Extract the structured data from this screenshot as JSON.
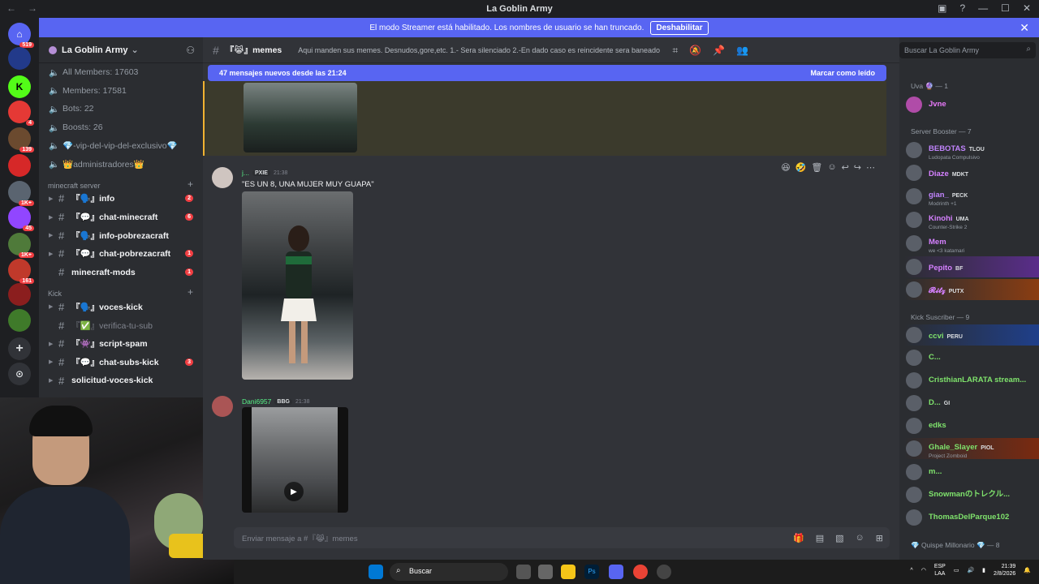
{
  "window": {
    "title": "La Goblin Army"
  },
  "banner": {
    "text": "El modo Streamer está habilitado. Los nombres de usuario se han truncado.",
    "button": "Deshabilitar"
  },
  "servers": [
    {
      "badge": "519"
    },
    {
      "badge": ""
    },
    {
      "badge": ""
    },
    {
      "badge": "4"
    },
    {
      "badge": "139"
    },
    {
      "badge": ""
    },
    {
      "badge": "1K+"
    },
    {
      "badge": "45"
    },
    {
      "badge": "1K+"
    },
    {
      "badge": "161"
    },
    {
      "badge": ""
    },
    {
      "badge": ""
    }
  ],
  "guild": {
    "name": "La Goblin Army"
  },
  "stats": [
    "All Members: 17603",
    "Members: 17581",
    "Bots: 22",
    "Boosts: 26",
    "💎-vip-del-vip-del-exclusivo💎",
    "👑administradores👑"
  ],
  "categories": {
    "minecraft": "minecraft server",
    "kick": "Kick"
  },
  "channels_mc": [
    {
      "name": "『🗣️』info",
      "badge": "2"
    },
    {
      "name": "『💬』chat-minecraft",
      "badge": "6"
    },
    {
      "name": "『🗣️』info-pobrezacraft",
      "badge": ""
    },
    {
      "name": "『💬』chat-pobrezacraft",
      "badge": "1"
    },
    {
      "name": "minecraft-mods",
      "badge": "1"
    }
  ],
  "channels_kick": [
    {
      "name": "『🗣️』voces-kick",
      "badge": ""
    },
    {
      "name": "『✅』verifica-tu-sub",
      "badge": ""
    },
    {
      "name": "『👾』script-spam",
      "badge": ""
    },
    {
      "name": "『💬』chat-subs-kick",
      "badge": "3"
    },
    {
      "name": "solicitud-voces-kick",
      "badge": ""
    }
  ],
  "header": {
    "channel": "『😹』memes",
    "topic": "Aqui manden sus memes. Desnudos,gore,etc. 1.- Sera silenciado 2.-En dado caso es reincidente sera baneado",
    "search_placeholder": "Buscar La Goblin Army"
  },
  "newbar": {
    "text": "47 mensajes nuevos desde las 21:24",
    "mark": "Marcar como leído"
  },
  "messages": [
    {
      "author": "j...",
      "tag": "PXIE",
      "time": "21:38",
      "text": "\"ES UN 8, UNA MUJER MUY GUAPA\""
    },
    {
      "author": "Dani6957",
      "tag": "BBG",
      "time": "21:38",
      "text": ""
    }
  ],
  "composer": {
    "placeholder": "Enviar mensaje a #『😹』memes"
  },
  "member_groups": [
    {
      "label": "Uva 🔮 — 1"
    },
    {
      "label": "Server Booster — 7"
    },
    {
      "label": "Kick Suscriber — 9"
    },
    {
      "label": "💎 Quispe Millonario 💎 — 8"
    }
  ],
  "members": [
    {
      "name": "Jvne",
      "sub": "",
      "tag": "",
      "color": "#e879f9"
    },
    {
      "name": "BEBOTAS",
      "sub": "Ludopata Compulsivo",
      "tag": "TLOU",
      "color": "#c084fc"
    },
    {
      "name": "Diaze",
      "sub": "",
      "tag": "MDKT",
      "color": "#d580ff"
    },
    {
      "name": "gian_",
      "sub": "Modrinth +1",
      "tag": "PECK",
      "color": "#c084fc"
    },
    {
      "name": "Kinohi",
      "sub": "Counter-Strike 2",
      "tag": "UMA",
      "color": "#d580ff"
    },
    {
      "name": "Mem",
      "sub": "we <3 katamari",
      "tag": "",
      "color": "#d580ff"
    },
    {
      "name": "Pepito",
      "sub": "",
      "tag": "BF",
      "color": "#d580ff"
    },
    {
      "name": "𝓡𝓲𝓽𝔃",
      "sub": "",
      "tag": "PUTX",
      "color": "#d580ff"
    },
    {
      "name": "ccvi",
      "sub": "",
      "tag": "PERU",
      "color": "#7fe36c"
    },
    {
      "name": "C...",
      "sub": "",
      "tag": "",
      "color": "#7fe36c"
    },
    {
      "name": "CristhianLARATA stream...",
      "sub": "",
      "tag": "",
      "color": "#7fe36c"
    },
    {
      "name": "D...",
      "sub": "",
      "tag": "GI",
      "color": "#7fe36c"
    },
    {
      "name": "edks",
      "sub": "",
      "tag": "",
      "color": "#7fe36c"
    },
    {
      "name": "Ghale_Slayer",
      "sub": "Project Zomboid",
      "tag": "PIOL",
      "color": "#7fe36c"
    },
    {
      "name": "m...",
      "sub": "",
      "tag": "",
      "color": "#7fe36c"
    },
    {
      "name": "Snowmanのトレクル...",
      "sub": "",
      "tag": "",
      "color": "#7fe36c"
    },
    {
      "name": "ThomasDelParque102",
      "sub": "",
      "tag": "",
      "color": "#7fe36c"
    }
  ],
  "taskbar": {
    "search": "Buscar",
    "lang_top": "ESP",
    "lang_bottom": "LAA",
    "time": "21:39",
    "date": "2/8/2026"
  },
  "colors": {
    "accent": "#5865f2",
    "mention": "#f0b232",
    "badge": "#f23f43"
  }
}
